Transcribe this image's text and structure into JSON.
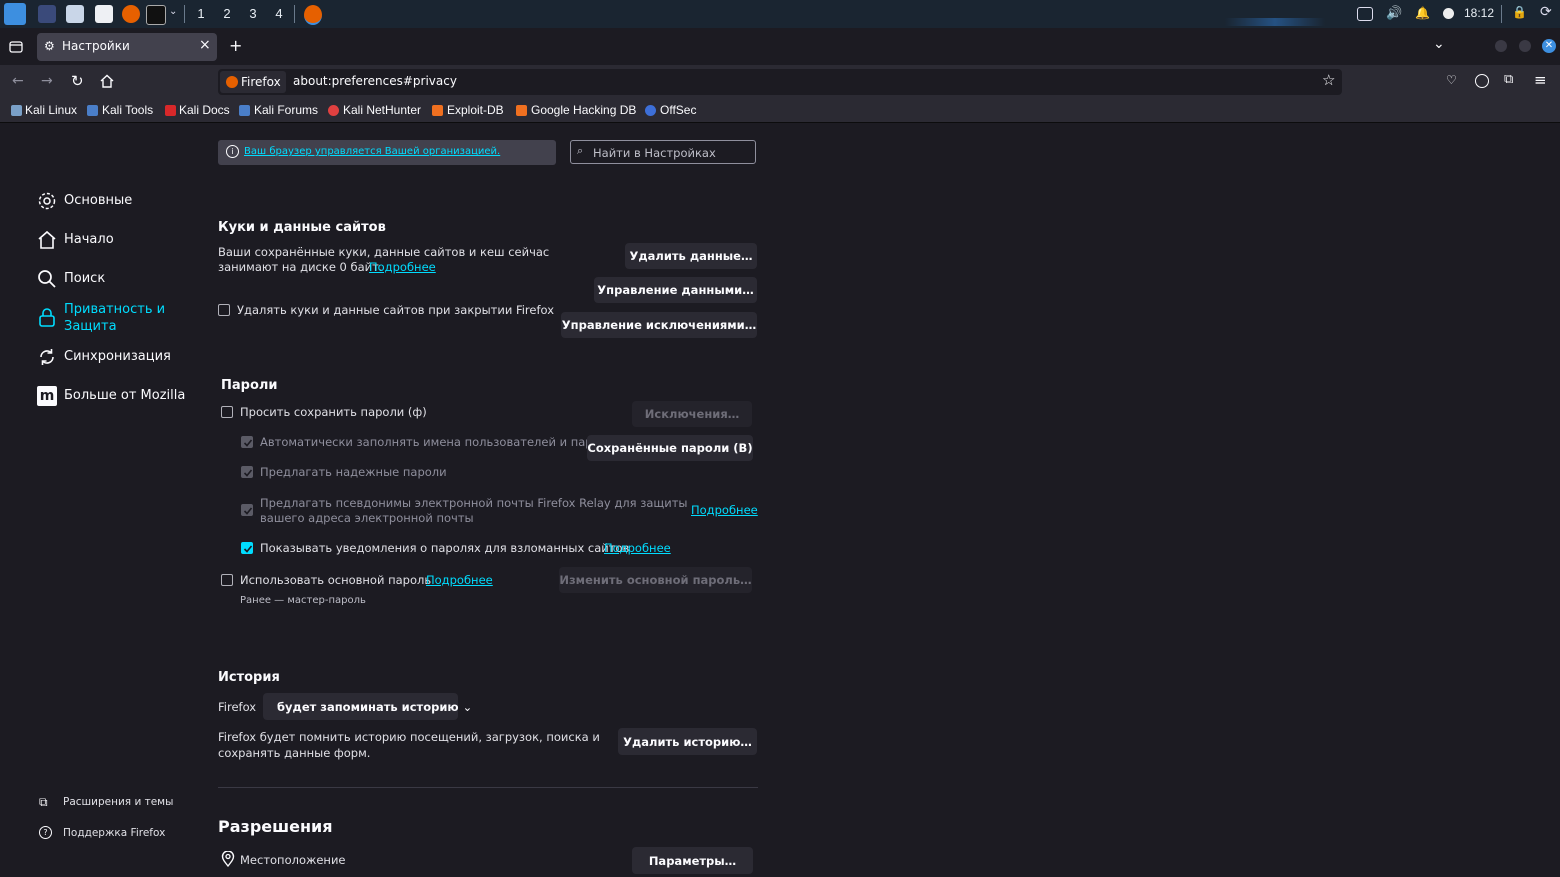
{
  "taskbar": {
    "workspaces": [
      "1",
      "2",
      "3",
      "4"
    ],
    "time": "18:12"
  },
  "tab": {
    "title": "Настройки",
    "close": "×",
    "new_tab": "+"
  },
  "urlbar": {
    "identity": "Firefox",
    "url": "about:preferences#privacy"
  },
  "bookmarks": [
    "Kali Linux",
    "Kali Tools",
    "Kali Docs",
    "Kali Forums",
    "Kali NetHunter",
    "Exploit-DB",
    "Google Hacking DB",
    "OffSec"
  ],
  "banner": {
    "managed": "Ваш браузер управляется Вашей организацией.",
    "search_placeholder": "Найти в Настройках"
  },
  "sidebar": {
    "items": [
      {
        "label": "Основные"
      },
      {
        "label": "Начало"
      },
      {
        "label": "Поиск"
      },
      {
        "label_1": "Приватность и",
        "label_2": "Защита"
      },
      {
        "label": "Синхронизация"
      },
      {
        "label": "Больше от Mozilla"
      }
    ],
    "footer": [
      "Расширения и темы",
      "Поддержка Firefox"
    ]
  },
  "cookies": {
    "heading": "Куки и данные сайтов",
    "desc_1": "Ваши сохранённые куки, данные сайтов и кеш сейчас",
    "desc_2": "занимают на диске 0 байт.",
    "learn_more": "Подробнее",
    "clear_button": "Удалить данные…",
    "manage_button": "Управление данными…",
    "exceptions_button": "Управление исключениями…",
    "delete_on_close": "Удалять куки и данные сайтов при закрытии Firefox"
  },
  "passwords": {
    "heading": "Пароли",
    "ask_save": "Просить сохранить пароли (ф)",
    "exceptions_button": "Исключения…",
    "autofill": "Автоматически заполнять имена пользователей и пароли",
    "saved_button": "Сохранённые пароли (В)",
    "suggest_strong": "Предлагать надежные пароли",
    "relay_1": "Предлагать псевдонимы электронной почты Firefox Relay для защиты",
    "relay_2": "вашего адреса электронной почты",
    "relay_learn_more": "Подробнее",
    "breach_alerts": "Показывать уведомления о паролях для взломанных сайтов",
    "breach_learn_more": "Подробнее",
    "primary_password": "Использовать основной пароль",
    "primary_learn_more": "Подробнее",
    "change_primary_button": "Изменить основной пароль…",
    "formerly": "Ранее — мастер-пароль"
  },
  "history": {
    "heading": "История",
    "firefox_label": "Firefox",
    "mode_select": "будет запоминать историю",
    "desc_1": "Firefox будет помнить историю посещений, загрузок, поиска и",
    "desc_2": "сохранять данные форм.",
    "clear_button": "Удалить историю…"
  },
  "permissions": {
    "heading": "Разрешения",
    "location": "Местоположение",
    "settings_button": "Параметры…"
  }
}
